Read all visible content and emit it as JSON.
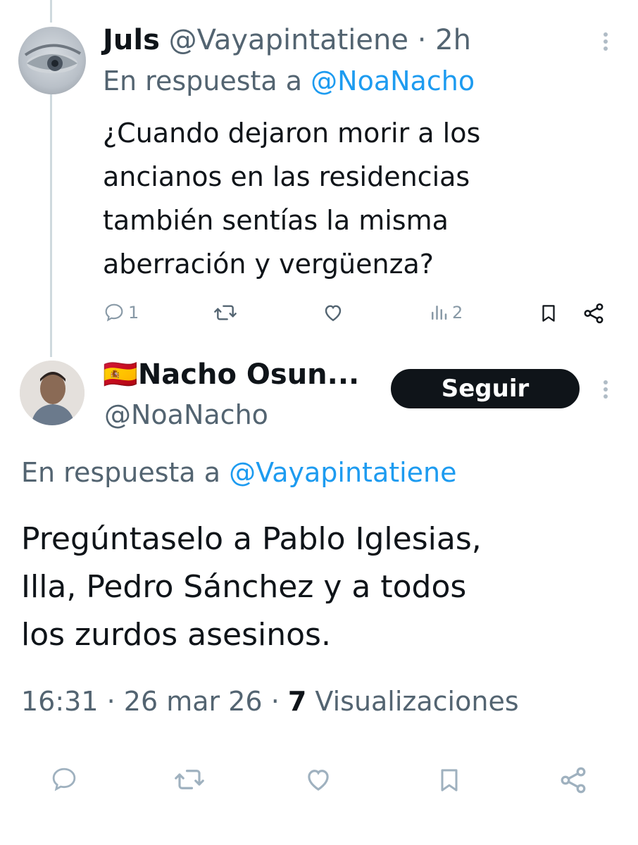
{
  "reply_tweet": {
    "display_name": "Juls",
    "handle": "@Vayapintatiene",
    "separator": "·",
    "time": "2h",
    "reply_prefix": "En respuesta a",
    "reply_to": "@NoaNacho",
    "text_lines": [
      "¿Cuando dejaron morir a los",
      "ancianos en las residencias",
      "también sentías la misma",
      "aberración y vergüenza?"
    ],
    "reply_count": "1",
    "views_count": "2",
    "icons": [
      "comment-icon",
      "retweet-icon",
      "like-icon",
      "views-icon",
      "bookmark-icon",
      "share-icon",
      "more-icon"
    ]
  },
  "main_tweet": {
    "flag": "🇪🇸",
    "display_name": "Nacho Osun...",
    "handle": "@NoaNacho",
    "follow_label": "Seguir",
    "reply_prefix": "En respuesta a",
    "reply_to": "@Vayapintatiene",
    "text_lines": [
      "Pregúntaselo a Pablo Iglesias,",
      "Illa, Pedro Sánchez y a todos",
      "los zurdos asesinos."
    ],
    "time": "16:31",
    "separator": "·",
    "date": "26 mar 26",
    "views_count": "7",
    "views_label": "Visualizaciones",
    "icons": [
      "comment-icon",
      "retweet-icon",
      "like-icon",
      "bookmark-icon",
      "share-icon"
    ]
  },
  "colors": {
    "link": "#1d9bf0",
    "muted": "#536471",
    "button_bg": "#0f1419"
  }
}
